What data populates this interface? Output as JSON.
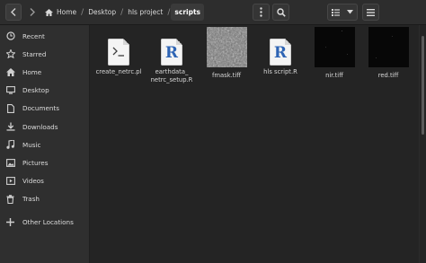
{
  "nav": {
    "back_icon": "chevron-left-icon",
    "forward_icon": "chevron-right-icon"
  },
  "breadcrumb": [
    {
      "label": "Home",
      "icon": "home-icon"
    },
    {
      "label": "Desktop"
    },
    {
      "label": "hls project"
    },
    {
      "label": "scripts"
    }
  ],
  "toolbar": {
    "menu_icon": "vertical-dots-icon",
    "search_icon": "search-icon",
    "view_icon": "view-options-icon",
    "dropdown_icon": "chevron-down-icon",
    "hamburger_icon": "hamburger-menu-icon"
  },
  "sidebar": {
    "items": [
      {
        "label": "Recent",
        "icon": "clock-icon"
      },
      {
        "label": "Starred",
        "icon": "star-icon"
      },
      {
        "label": "Home",
        "icon": "home-icon"
      },
      {
        "label": "Desktop",
        "icon": "desktop-icon"
      },
      {
        "label": "Documents",
        "icon": "document-icon"
      },
      {
        "label": "Downloads",
        "icon": "download-icon"
      },
      {
        "label": "Music",
        "icon": "music-icon"
      },
      {
        "label": "Pictures",
        "icon": "pictures-icon"
      },
      {
        "label": "Videos",
        "icon": "video-icon"
      },
      {
        "label": "Trash",
        "icon": "trash-icon"
      },
      {
        "label": "Other Locations",
        "icon": "plus-icon"
      }
    ]
  },
  "files": [
    {
      "name": "create_netrc.pl",
      "type": "script"
    },
    {
      "name": "earthdata_\nnetrc_setup.R",
      "type": "r"
    },
    {
      "name": "fmask.tiff",
      "type": "image-noise"
    },
    {
      "name": "hls script.R",
      "type": "r"
    },
    {
      "name": "nir.tiff",
      "type": "image-dark"
    },
    {
      "name": "red.tiff",
      "type": "image-dark"
    }
  ]
}
